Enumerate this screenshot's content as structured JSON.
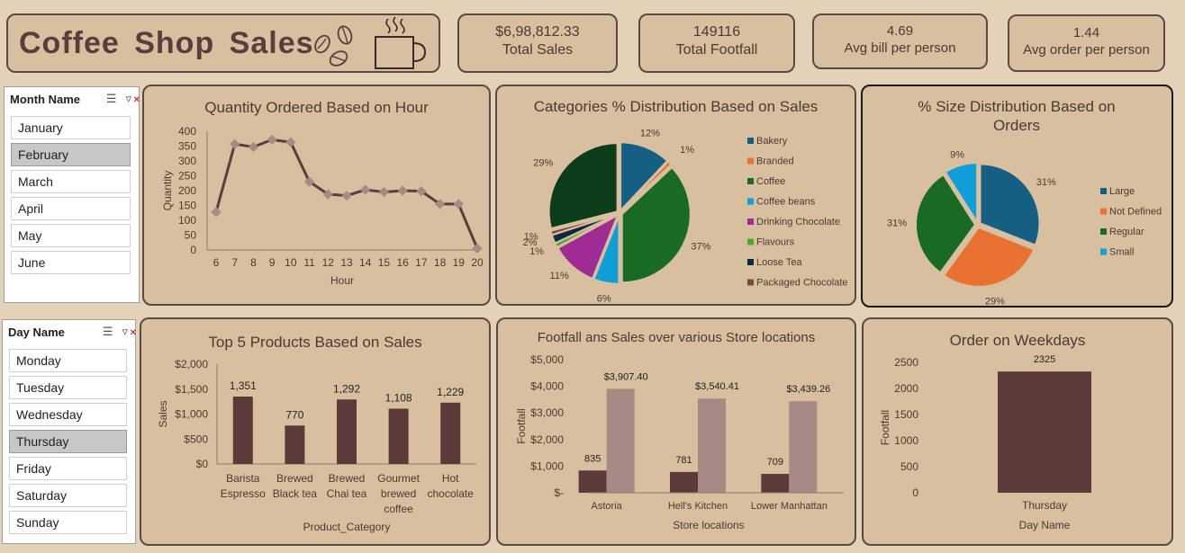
{
  "header": {
    "title": "Coffee Shop Sales"
  },
  "kpis": [
    {
      "value": "$6,98,812.33",
      "label": "Total Sales"
    },
    {
      "value": "149116",
      "label": "Total Footfall"
    },
    {
      "value": "4.69",
      "label": "Avg bill per person"
    },
    {
      "value": "1.44",
      "label": "Avg order per  person"
    }
  ],
  "month_slicer": {
    "title": "Month Name",
    "items": [
      "January",
      "February",
      "March",
      "April",
      "May",
      "June"
    ],
    "selected": "February"
  },
  "day_slicer": {
    "title": "Day Name",
    "items": [
      "Monday",
      "Tuesday",
      "Wednesday",
      "Thursday",
      "Friday",
      "Saturday",
      "Sunday"
    ],
    "selected": "Thursday"
  },
  "chart_data": [
    {
      "type": "line",
      "title": "Quantity Ordered Based on Hour",
      "xlabel": "Hour",
      "ylabel": "Quantity",
      "x": [
        6,
        7,
        8,
        9,
        10,
        11,
        12,
        13,
        14,
        15,
        16,
        17,
        18,
        19,
        20
      ],
      "values": [
        128,
        357,
        347,
        372,
        363,
        230,
        188,
        183,
        203,
        195,
        200,
        198,
        155,
        155,
        5
      ],
      "ylim": [
        0,
        400
      ],
      "yticks": [
        "400",
        "350",
        "300",
        "250",
        "200",
        "150",
        "100",
        "50",
        "0"
      ],
      "color": "#5c3d3d"
    },
    {
      "type": "pie",
      "title": "Categories % Distribution Based on Sales",
      "categories": [
        "Bakery",
        "Branded",
        "Coffee",
        "Coffee beans",
        "Drinking Chocolate",
        "Flavours",
        "Loose Tea",
        "Packaged Chocolate"
      ],
      "values": [
        12,
        1,
        37,
        6,
        11,
        1,
        2,
        1,
        29
      ],
      "slice_labels": [
        "12%",
        "1%",
        "37%",
        "6%",
        "11%",
        "1%",
        "2%",
        "1%",
        "29%"
      ],
      "colors": [
        "#156082",
        "#e97132",
        "#196b24",
        "#0f9ed5",
        "#a02b93",
        "#4ea72e",
        "#0e2841",
        "#7b4a35",
        "#0c3d1a"
      ],
      "legend": "right"
    },
    {
      "type": "pie",
      "title": "% Size Distribution Based on Orders",
      "categories": [
        "Large",
        "Not Defined",
        "Regular",
        "Small"
      ],
      "values": [
        31,
        29,
        31,
        9
      ],
      "slice_labels": [
        "31%",
        "29%",
        "31%",
        "9%"
      ],
      "colors": [
        "#156082",
        "#e97132",
        "#196b24",
        "#0f9ed5"
      ],
      "legend": "right"
    },
    {
      "type": "bar",
      "title": "Top 5 Products Based on Sales",
      "xlabel": "Product_Category",
      "ylabel": "Sales",
      "categories": [
        [
          "Barista",
          "Espresso"
        ],
        [
          "Brewed",
          "Black tea"
        ],
        [
          "Brewed",
          "Chai tea"
        ],
        [
          "Gourmet",
          "brewed",
          "coffee"
        ],
        [
          "Hot",
          "chocolate"
        ]
      ],
      "values": [
        1351,
        770,
        1292,
        1108,
        1229
      ],
      "data_labels": [
        "1,351",
        "770",
        "1,292",
        "1,108",
        "1,229"
      ],
      "ylim": [
        0,
        2000
      ],
      "yticks": [
        "$2,000",
        "$1,500",
        "$1,000",
        "$500",
        "$0"
      ],
      "color": "#5c3a3a"
    },
    {
      "type": "bar",
      "title": "Footfall ans Sales over various Store locations",
      "xlabel": "Store locations",
      "ylabel": "Footfall",
      "categories": [
        "Astoria",
        "Hell's Kitchen",
        "Lower Manhattan"
      ],
      "series": [
        {
          "values": [
            835,
            781,
            709
          ],
          "labels": [
            "835",
            "781",
            "709"
          ],
          "color": "#5c3a3a"
        },
        {
          "values": [
            3907.4,
            3540.41,
            3439.26
          ],
          "labels": [
            "$3,907.40",
            "$3,540.41",
            "$3,439.26"
          ],
          "color": "#a88a84"
        }
      ],
      "ylim": [
        0,
        5000
      ],
      "yticks": [
        "$5,000",
        "$4,000",
        "$3,000",
        "$2,000",
        "$1,000",
        "$-"
      ]
    },
    {
      "type": "bar",
      "title": "Order on Weekdays",
      "xlabel": "Day Name",
      "ylabel": "Footfall",
      "categories": [
        "Thursday"
      ],
      "values": [
        2325
      ],
      "data_labels": [
        "2325"
      ],
      "ylim": [
        0,
        2500
      ],
      "yticks": [
        "2500",
        "2000",
        "1500",
        "1000",
        "500",
        "0"
      ],
      "color": "#5c3a3a"
    }
  ]
}
